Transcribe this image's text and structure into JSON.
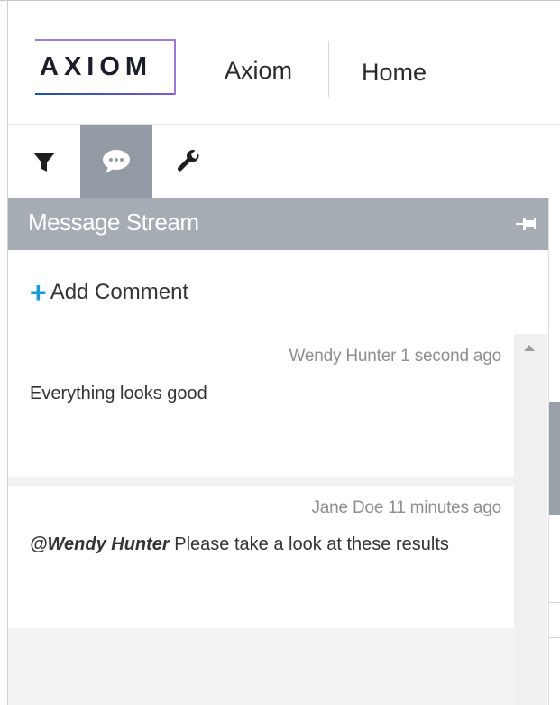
{
  "header": {
    "logo_text": "AXIOM",
    "app_name": "Axiom",
    "page_name": "Home"
  },
  "toolbar": {
    "items": [
      {
        "icon": "filter-icon",
        "active": false
      },
      {
        "icon": "comment-icon",
        "active": true
      },
      {
        "icon": "wrench-icon",
        "active": false
      }
    ]
  },
  "panel": {
    "title": "Message Stream",
    "pin_icon": "pin-icon",
    "add_comment_label": "Add Comment"
  },
  "messages": [
    {
      "meta": "Wendy Hunter 1 second ago",
      "text": "Everything looks good"
    },
    {
      "meta": "Jane Doe 11 minutes ago",
      "mention": "@Wendy Hunter",
      "text": " Please take a look at these results"
    }
  ],
  "colors": {
    "accent": "#1a9ad6",
    "panel_header": "#a5acb3",
    "active_tool": "#929aa3",
    "logo_border": "#9a7bd8"
  }
}
